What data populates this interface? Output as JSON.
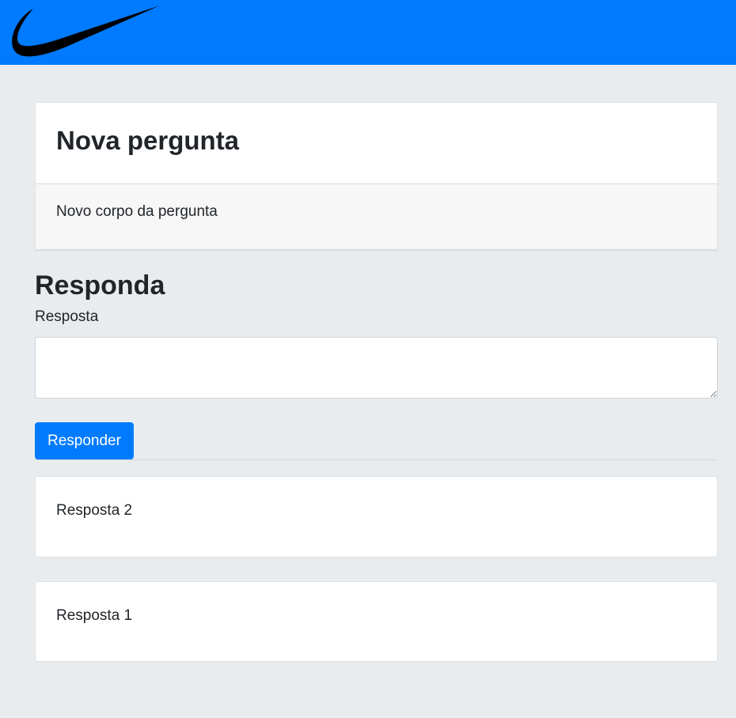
{
  "navbar": {
    "background": "#007bff",
    "logo": {
      "icon": "swoosh-logo-icon",
      "color": "#000000"
    }
  },
  "question": {
    "title": "Nova pergunta",
    "body": "Novo corpo da pergunta"
  },
  "answer_form": {
    "heading": "Responda",
    "label": "Resposta",
    "input_value": "",
    "submit_label": "Responder",
    "accent": "#007bff"
  },
  "answers": [
    {
      "text": "Resposta 2"
    },
    {
      "text": "Resposta 1"
    }
  ]
}
